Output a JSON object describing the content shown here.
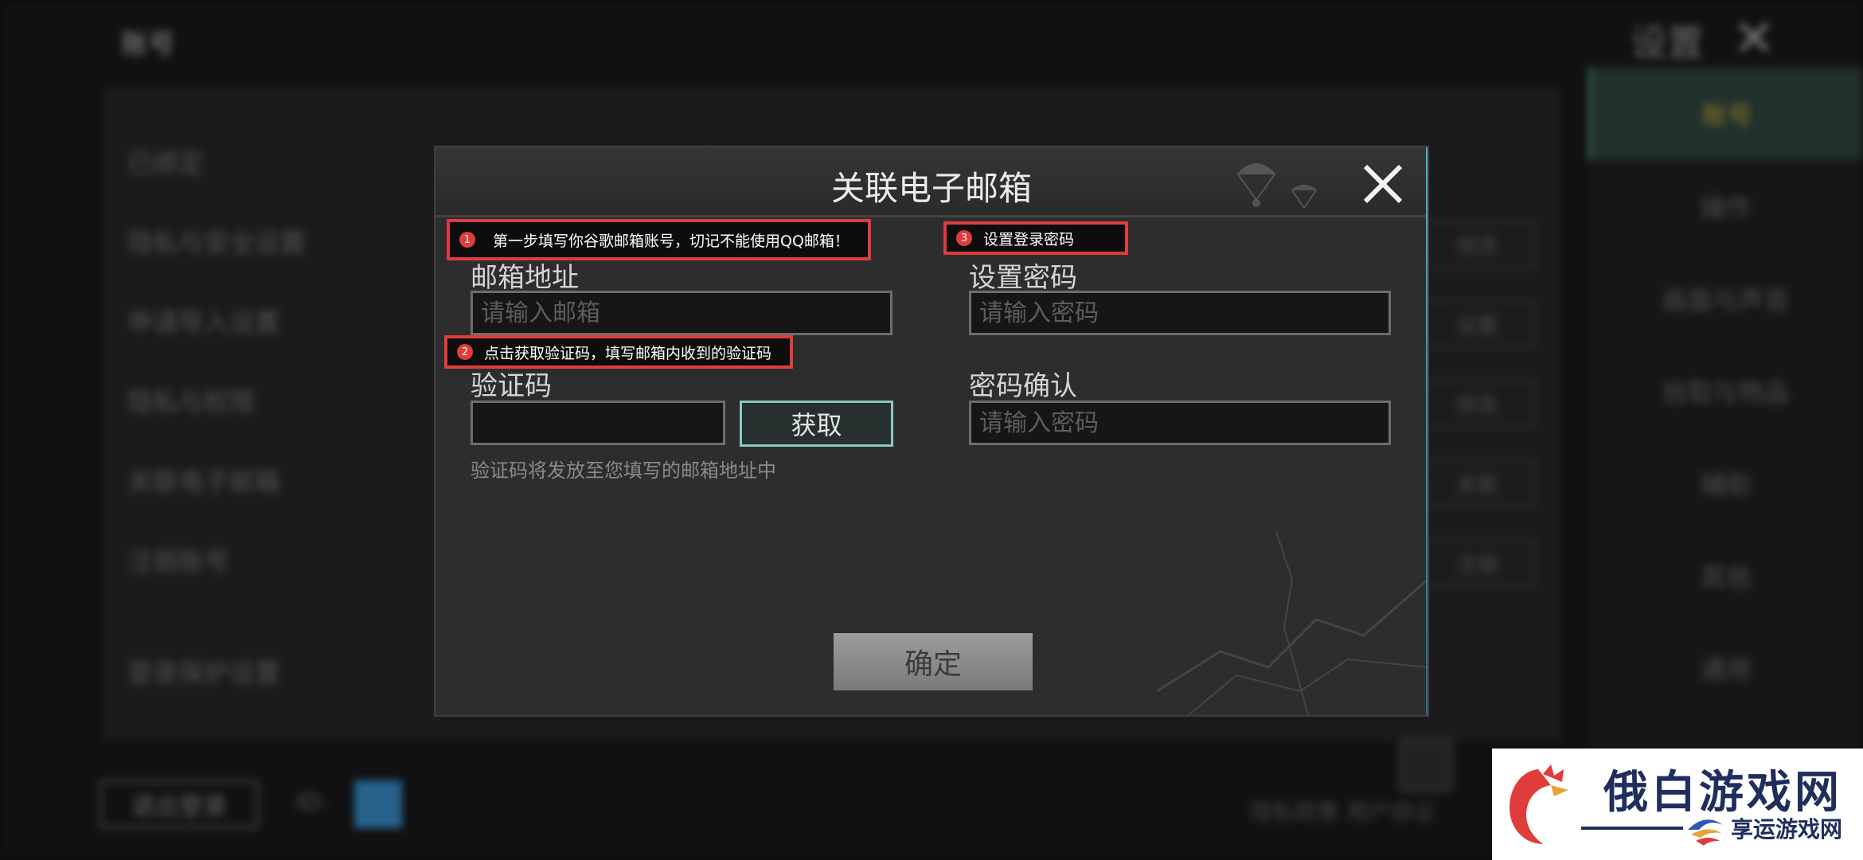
{
  "background": {
    "title": "账号",
    "settings_label": "设置",
    "rows": [
      "已绑定",
      "隐私与安全设置",
      "申请导入设置",
      "隐私与权限",
      "关联电子邮箱",
      "注销账号",
      "登录保护设置"
    ],
    "tabs": [
      "账号",
      "操作",
      "画面与声音",
      "拾取与物品",
      "辅助",
      "其他",
      "通用"
    ],
    "chips": [
      "修改",
      "设置",
      "修改",
      "关联",
      "注销"
    ],
    "logout_label": "退出登录",
    "id_label": "ID:",
    "bottom_text": "隐私政策    用户协议"
  },
  "modal": {
    "title": "关联电子邮箱",
    "email_label": "邮箱地址",
    "email_placeholder": "请输入邮箱",
    "code_label": "验证码",
    "code_value": "",
    "get_code_label": "获取",
    "code_hint": "验证码将发放至您填写的邮箱地址中",
    "password_label": "设置密码",
    "password_placeholder": "请输入密码",
    "confirm_label": "密码确认",
    "confirm_placeholder": "请输入密码",
    "confirm_button": "确定"
  },
  "annotations": [
    {
      "num": "1",
      "text": "第一步填写你谷歌邮箱账号，切记不能使用QQ邮箱！"
    },
    {
      "num": "2",
      "text": "点击获取验证码，填写邮箱内收到的验证码"
    },
    {
      "num": "3",
      "text": "设置登录密码"
    }
  ],
  "watermark": {
    "main": "俄白游戏网",
    "sub": "享运游戏网"
  },
  "colors": {
    "annotation_red": "#e03c3c",
    "accent_teal": "#8cc8c2",
    "watermark_navy": "#1f2e5c"
  }
}
